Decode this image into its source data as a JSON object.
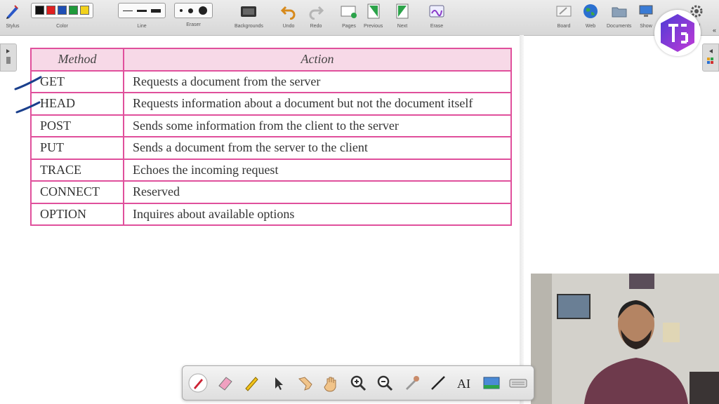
{
  "toolbar": {
    "stylus": "Stylus",
    "color": "Color",
    "line": "Line",
    "eraser": "Eraser",
    "backgrounds": "Backgrounds",
    "undo": "Undo",
    "redo": "Redo",
    "pages": "Pages",
    "previous": "Previous",
    "next": "Next",
    "erase": "Erase",
    "board": "Board",
    "web": "Web",
    "documents": "Documents",
    "show": "Show",
    "settings_partial": "ard",
    "more": "«",
    "colors": [
      "#111111",
      "#e02020",
      "#1f4fb5",
      "#1f9a3a",
      "#f2d21b"
    ]
  },
  "table": {
    "headers": [
      "Method",
      "Action"
    ],
    "rows": [
      [
        "GET",
        "Requests a document from the server"
      ],
      [
        "HEAD",
        "Requests information about a document but not the document itself"
      ],
      [
        "POST",
        "Sends some information from the client to the server"
      ],
      [
        "PUT",
        "Sends a document from the server to the client"
      ],
      [
        "TRACE",
        "Echoes the incoming request"
      ],
      [
        "CONNECT",
        "Reserved"
      ],
      [
        "OPTION",
        "Inquires about available options"
      ]
    ]
  },
  "dock": {
    "icons": [
      "pen-icon",
      "eraser-icon",
      "highlighter-icon",
      "cursor-icon",
      "pointer-hand-icon",
      "grab-hand-icon",
      "zoom-in-icon",
      "zoom-out-icon",
      "color-picker-icon",
      "line-tool-icon",
      "text-tool-icon",
      "screen-capture-icon",
      "keyboard-icon"
    ],
    "text_tool": "AI"
  }
}
